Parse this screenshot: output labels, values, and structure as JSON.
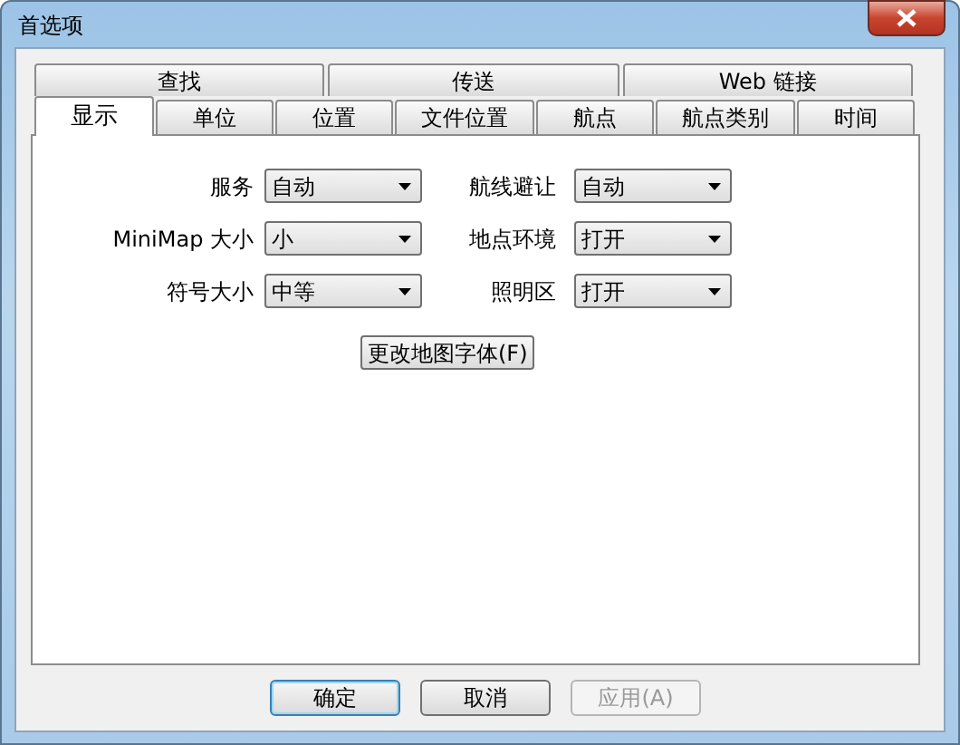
{
  "window": {
    "title": "首选项"
  },
  "tab_rows": [
    [
      {
        "label": "查找",
        "selected": false
      },
      {
        "label": "传送",
        "selected": false
      },
      {
        "label": "Web 链接",
        "selected": false
      }
    ],
    [
      {
        "label": "显示",
        "selected": true
      },
      {
        "label": "单位",
        "selected": false
      },
      {
        "label": "位置",
        "selected": false
      },
      {
        "label": "文件位置",
        "selected": false
      },
      {
        "label": "航点",
        "selected": false
      },
      {
        "label": "航点类别",
        "selected": false
      },
      {
        "label": "时间",
        "selected": false
      }
    ]
  ],
  "settings": [
    {
      "label": "服务",
      "value": "自动"
    },
    {
      "label": "航线避让",
      "value": "自动"
    },
    {
      "label": "MiniMap 大小",
      "value": "小"
    },
    {
      "label": "地点环境",
      "value": "打开"
    },
    {
      "label": "符号大小",
      "value": "中等"
    },
    {
      "label": "照明区",
      "value": "打开"
    }
  ],
  "font_button": {
    "label": "更改地图字体(F)"
  },
  "buttons": [
    {
      "label": "确定",
      "default": true,
      "disabled": false
    },
    {
      "label": "取消",
      "default": false,
      "disabled": false
    },
    {
      "label": "应用(A)",
      "default": false,
      "disabled": true
    }
  ]
}
